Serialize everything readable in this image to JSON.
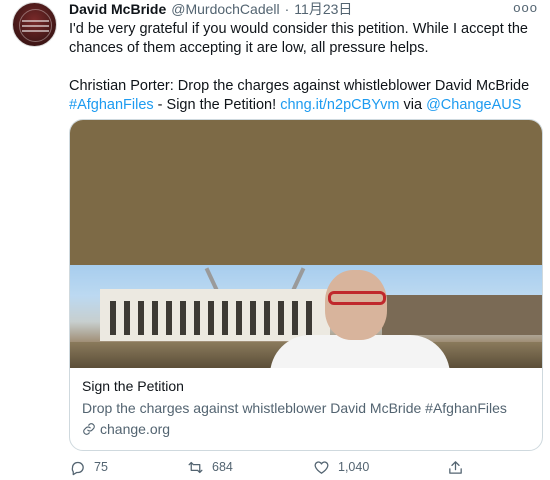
{
  "tweet": {
    "author_name": "David McBride",
    "handle": "@MurdochCadell",
    "separator": "·",
    "date": "11月23日",
    "more_label": "ooo",
    "text_line1": "I'd be very grateful if you would consider this petition. While I accept the chances of them accepting it are low, all pressure helps.",
    "text_line2_prefix": "Christian Porter: Drop the charges against whistleblower David McBride",
    "hashtag": "#AfghanFiles",
    "text_mid": " - Sign the Petition! ",
    "short_link": "chng.it/n2pCBYvm",
    "via": " via ",
    "mention": "@ChangeAUS"
  },
  "card": {
    "title": "Sign the Petition",
    "description": "Drop the charges against whistleblower David McBride #AfghanFiles",
    "domain": "change.org"
  },
  "actions": {
    "replies": "75",
    "retweets": "684",
    "likes": "1,040"
  },
  "icons": {
    "reply": "reply-icon",
    "retweet": "retweet-icon",
    "like": "heart-icon",
    "share": "share-icon",
    "link": "link-icon",
    "more": "more-icon"
  },
  "colors": {
    "link": "#1d9bf0",
    "secondary_text": "#536471",
    "primary_text": "#0f1419",
    "card_border": "#cfd9de",
    "media_background": "#7d6a46"
  }
}
